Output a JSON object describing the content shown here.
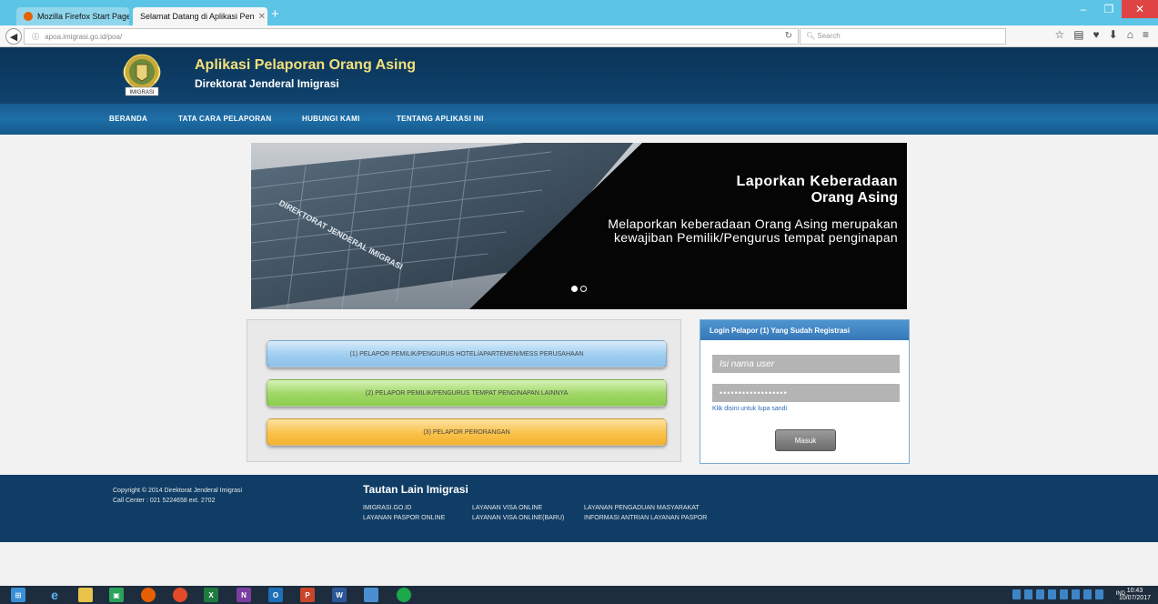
{
  "browser": {
    "tabs": [
      {
        "label": "Mozilla Firefox Start Page"
      },
      {
        "label": "Selamat Datang di Aplikasi Pen"
      }
    ],
    "url": "apoa.imigrasi.go.id/poa/",
    "search_placeholder": "Search"
  },
  "header": {
    "title": "Aplikasi Pelaporan Orang Asing",
    "subtitle": "Direktorat Jenderal Imigrasi",
    "logo_text": "IMIGRASI"
  },
  "menu": [
    {
      "label": "BERANDA"
    },
    {
      "label": "TATA CARA PELAPORAN"
    },
    {
      "label": "HUBUNGI KAMI"
    },
    {
      "label": "TENTANG APLIKASI INI"
    }
  ],
  "banner": {
    "title_line1": "Laporkan Keberadaan",
    "title_line2": "Orang Asing",
    "text": "Melaporkan keberadaan Orang Asing merupakan kewajiban Pemilik/Pengurus tempat penginapan",
    "building_sign": "DIREKTORAT JENDERAL IMIGRASI"
  },
  "reporters": {
    "option1": "(1) PELAPOR PEMILIK/PENGURUS HOTEL/APARTEMEN/MESS PERUSAHAAN",
    "option2": "(2) PELAPOR PEMILIK/PENGURUS TEMPAT PENGINAPAN LAINNYA",
    "option3": "(3) PELAPOR PERORANGAN"
  },
  "login": {
    "heading": "Login Pelapor (1) Yang Sudah Registrasi",
    "username_placeholder": "Isi nama user",
    "password_value": "••••••••••••••••••",
    "forgot_link": "Klik disini untuk lupa sandi",
    "submit_label": "Masuk"
  },
  "footer": {
    "copyright": "Copyright © 2014 Direktorat Jenderal Imigrasi",
    "call_center": "Call Center : 021 5224658 ext. 2702",
    "links_title": "Tautan Lain Imigrasi",
    "links": [
      "IMIGRASI.GO.ID",
      "LAYANAN PASPOR ONLINE",
      "LAYANAN VISA ONLINE",
      "LAYANAN VISA ONLINE(BARU)",
      "LAYANAN PENGADUAN MASYARAKAT",
      "INFORMASI ANTRIAN LAYANAN PASPOR"
    ]
  },
  "taskbar": {
    "lang": "IND",
    "time": "10:43",
    "date": "10/07/2017"
  }
}
